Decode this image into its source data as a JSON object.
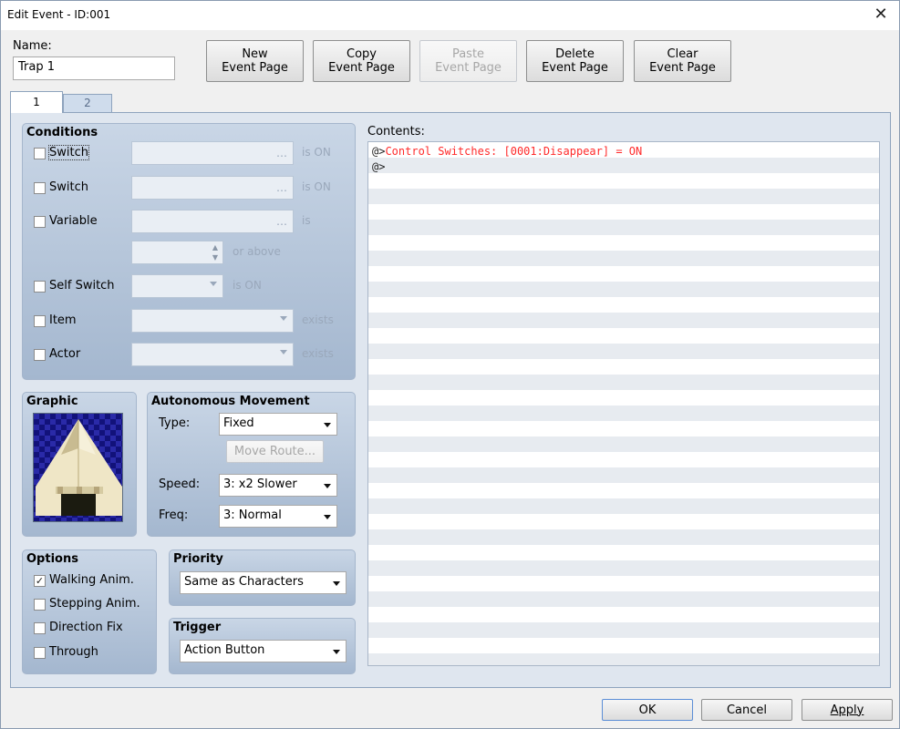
{
  "window": {
    "title": "Edit Event - ID:001",
    "close_glyph": "✕"
  },
  "name": {
    "label": "Name:",
    "value": "Trap 1"
  },
  "toolbar": {
    "new": [
      "New",
      "Event Page"
    ],
    "copy": [
      "Copy",
      "Event Page"
    ],
    "paste": [
      "Paste",
      "Event Page"
    ],
    "delete": [
      "Delete",
      "Event Page"
    ],
    "clear": [
      "Clear",
      "Event Page"
    ]
  },
  "tabs": [
    {
      "label": "1",
      "active": true
    },
    {
      "label": "2",
      "active": false
    }
  ],
  "conditions": {
    "title": "Conditions",
    "switch1": {
      "label": "Switch",
      "suffix": "is ON",
      "checked": false
    },
    "switch2": {
      "label": "Switch",
      "suffix": "is ON",
      "checked": false
    },
    "variable": {
      "label": "Variable",
      "suffix": "is",
      "stepper_suffix": "or above",
      "checked": false
    },
    "self_switch": {
      "label": "Self Switch",
      "suffix": "is ON",
      "checked": false
    },
    "item": {
      "label": "Item",
      "suffix": "exists",
      "checked": false
    },
    "actor": {
      "label": "Actor",
      "suffix": "exists",
      "checked": false
    }
  },
  "graphic": {
    "title": "Graphic"
  },
  "movement": {
    "title": "Autonomous Movement",
    "type_label": "Type:",
    "type_value": "Fixed",
    "move_route": "Move Route...",
    "speed_label": "Speed:",
    "speed_value": "3: x2 Slower",
    "freq_label": "Freq:",
    "freq_value": "3: Normal"
  },
  "options": {
    "title": "Options",
    "walking": {
      "label": "Walking Anim.",
      "checked": true
    },
    "stepping": {
      "label": "Stepping Anim.",
      "checked": false
    },
    "direction_fix": {
      "label": "Direction Fix",
      "checked": false
    },
    "through": {
      "label": "Through",
      "checked": false
    }
  },
  "priority": {
    "title": "Priority",
    "value": "Same as Characters"
  },
  "trigger": {
    "title": "Trigger",
    "value": "Action Button"
  },
  "contents": {
    "label": "Contents:",
    "lines": [
      {
        "prefix": "@>",
        "command": "Control Switches: [0001:Disappear] = ON"
      },
      {
        "prefix": "@>",
        "command": ""
      }
    ]
  },
  "footer": {
    "ok": "OK",
    "cancel": "Cancel",
    "apply": "Apply"
  },
  "colors": {
    "accent": "#a4b7cf",
    "command_text": "#ff2a2a"
  }
}
